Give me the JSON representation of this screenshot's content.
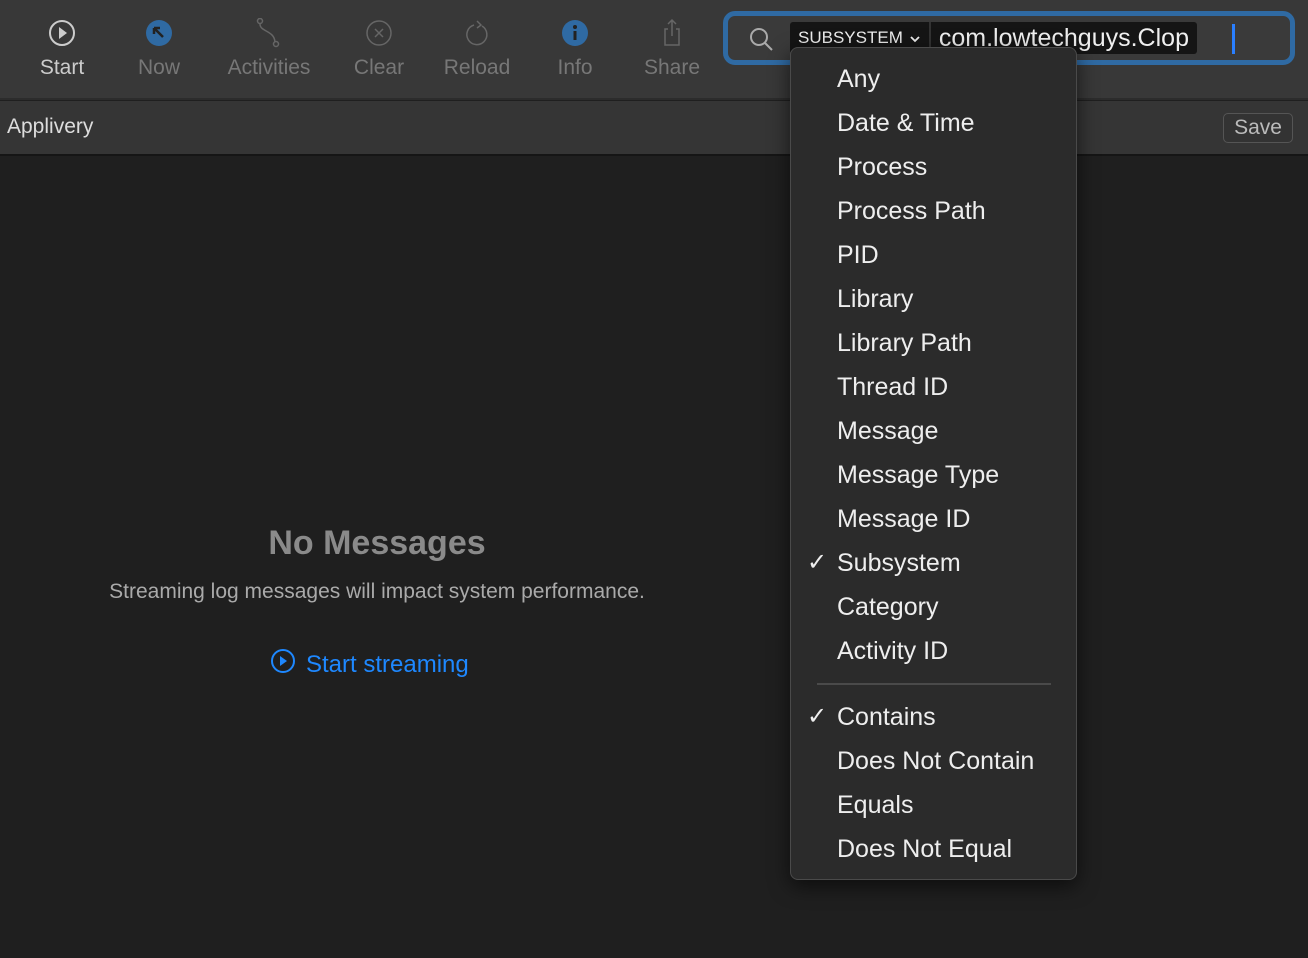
{
  "toolbar": {
    "items": [
      {
        "label": "Start",
        "icon": "play-circle-icon"
      },
      {
        "label": "Now",
        "icon": "arrow-up-left-circle-icon"
      },
      {
        "label": "Activities",
        "icon": "path-icon"
      },
      {
        "label": "Clear",
        "icon": "x-circle-icon"
      },
      {
        "label": "Reload",
        "icon": "reload-icon"
      },
      {
        "label": "Info",
        "icon": "info-circle-icon"
      },
      {
        "label": "Share",
        "icon": "share-icon"
      }
    ]
  },
  "search": {
    "token_key": "SUBSYSTEM",
    "token_value": "com.lowtechguys.Clop"
  },
  "subbar": {
    "scope": "Applivery",
    "save": "Save"
  },
  "main": {
    "title": "No Messages",
    "subtitle": "Streaming log messages will impact system performance.",
    "start_streaming": "Start streaming"
  },
  "menu": {
    "fields": [
      "Any",
      "Date & Time",
      "Process",
      "Process Path",
      "PID",
      "Library",
      "Library Path",
      "Thread ID",
      "Message",
      "Message Type",
      "Message ID",
      "Subsystem",
      "Category",
      "Activity ID"
    ],
    "selected_field": "Subsystem",
    "operators": [
      "Contains",
      "Does Not Contain",
      "Equals",
      "Does Not Equal"
    ],
    "selected_operator": "Contains",
    "check": "✓"
  },
  "colors": {
    "accent": "#1e88ff",
    "focus_ring": "#2f6aa3",
    "icon_blue": "#2f6aa3"
  }
}
